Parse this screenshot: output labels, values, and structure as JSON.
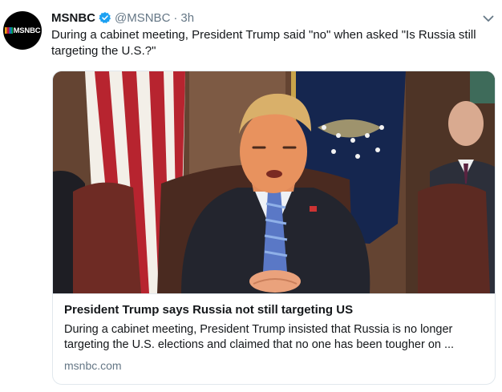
{
  "account": {
    "name": "MSNBC",
    "handle": "@MSNBC",
    "separator": "·",
    "time": "3h",
    "verified": true,
    "avatar_text": "MSNBC"
  },
  "tweet": {
    "text": "During a cabinet meeting, President Trump said \"no\" when asked \"Is Russia still targeting the U.S.?\""
  },
  "card": {
    "title": "President Trump says Russia not still targeting US",
    "description": "During a cabinet meeting, President Trump insisted that Russia is no longer targeting the U.S. elections and claimed that no one has been tougher on ...",
    "domain": "msnbc.com"
  },
  "icons": {
    "verified": "verified-badge-icon",
    "caret": "chevron-down-icon",
    "logo": "msnbc-peacock-logo"
  },
  "colors": {
    "verified": "#1da1f2",
    "secondary_text": "#657786",
    "border": "#e1e8ed"
  }
}
